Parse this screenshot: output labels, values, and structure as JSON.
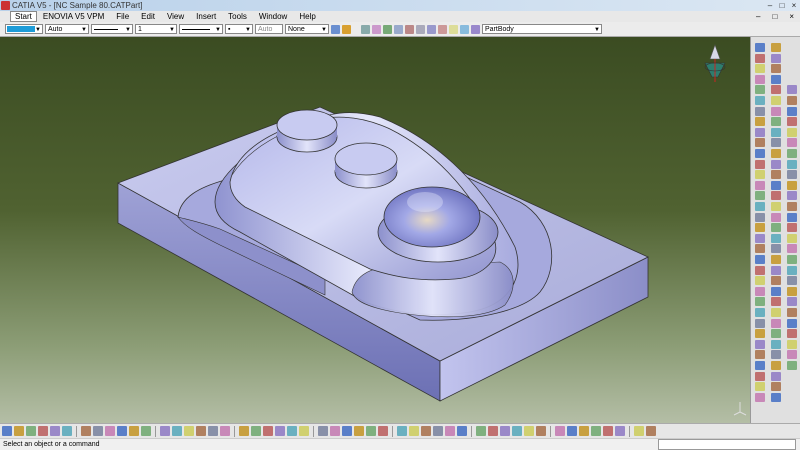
{
  "window": {
    "title": "CATIA V5 - [NC Sample 80.CATPart]",
    "controls": [
      "–",
      "□",
      "×"
    ]
  },
  "menu": {
    "items": [
      "Start",
      "ENOVIA V5 VPM",
      "File",
      "Edit",
      "View",
      "Insert",
      "Tools",
      "Window",
      "Help"
    ],
    "doc_controls": [
      "–",
      "□",
      "×"
    ]
  },
  "properties_toolbar": {
    "fill_color": "#1e9cd8",
    "color_mode": "Auto",
    "line_weight": "1",
    "point_style": "▪",
    "layer_auto": "Auto",
    "layer": "None",
    "body": "PartBody"
  },
  "viewport": {
    "background_top": "#3b4c22",
    "background_bottom": "#b4bea6",
    "part_color": "#b9bce8"
  },
  "status": {
    "message": "Select an object or a command"
  }
}
